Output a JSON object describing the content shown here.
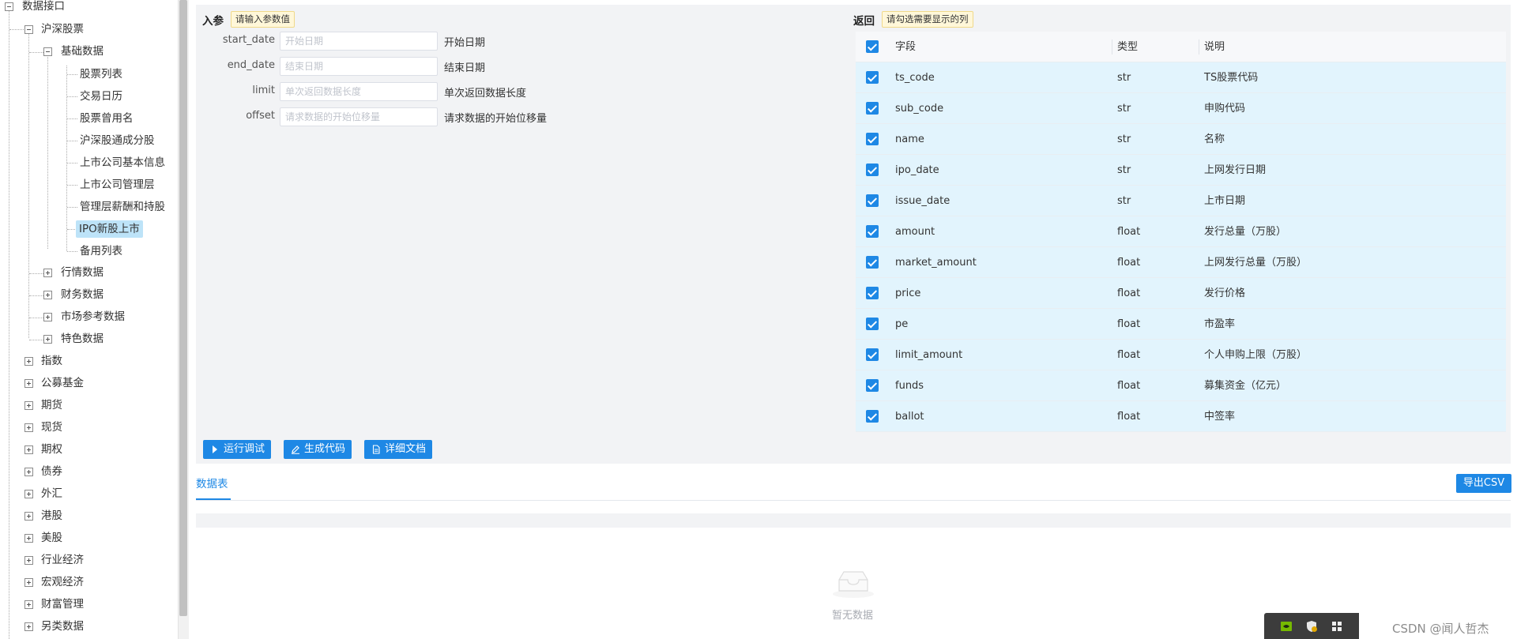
{
  "tree": {
    "root": "数据接口",
    "stock": "沪深股票",
    "basic": "基础数据",
    "leaves": [
      "股票列表",
      "交易日历",
      "股票曾用名",
      "沪深股通成分股",
      "上市公司基本信息",
      "上市公司管理层",
      "管理层薪酬和持股",
      "IPO新股上市",
      "备用列表"
    ],
    "stock_children": [
      "行情数据",
      "财务数据",
      "市场参考数据",
      "特色数据"
    ],
    "top_level": [
      "指数",
      "公募基金",
      "期货",
      "现货",
      "期权",
      "债券",
      "外汇",
      "港股",
      "美股",
      "行业经济",
      "宏观经济",
      "财富管理",
      "另类数据"
    ]
  },
  "params": {
    "title": "入参",
    "hint": "请输入参数值",
    "items": [
      {
        "label": "start_date",
        "placeholder": "开始日期",
        "desc": "开始日期"
      },
      {
        "label": "end_date",
        "placeholder": "结束日期",
        "desc": "结束日期"
      },
      {
        "label": "limit",
        "placeholder": "单次返回数据长度",
        "desc": "单次返回数据长度"
      },
      {
        "label": "offset",
        "placeholder": "请求数据的开始位移量",
        "desc": "请求数据的开始位移量"
      }
    ]
  },
  "returns": {
    "title": "返回",
    "hint": "请勾选需要显示的列",
    "headers": {
      "field": "字段",
      "type": "类型",
      "desc": "说明"
    },
    "rows": [
      {
        "field": "ts_code",
        "type": "str",
        "desc": "TS股票代码"
      },
      {
        "field": "sub_code",
        "type": "str",
        "desc": "申购代码"
      },
      {
        "field": "name",
        "type": "str",
        "desc": "名称"
      },
      {
        "field": "ipo_date",
        "type": "str",
        "desc": "上网发行日期"
      },
      {
        "field": "issue_date",
        "type": "str",
        "desc": "上市日期"
      },
      {
        "field": "amount",
        "type": "float",
        "desc": "发行总量（万股）"
      },
      {
        "field": "market_amount",
        "type": "float",
        "desc": "上网发行总量（万股）"
      },
      {
        "field": "price",
        "type": "float",
        "desc": "发行价格"
      },
      {
        "field": "pe",
        "type": "float",
        "desc": "市盈率"
      },
      {
        "field": "limit_amount",
        "type": "float",
        "desc": "个人申购上限（万股）"
      },
      {
        "field": "funds",
        "type": "float",
        "desc": "募集资金（亿元）"
      },
      {
        "field": "ballot",
        "type": "float",
        "desc": "中签率"
      }
    ]
  },
  "buttons": {
    "run": "运行调试",
    "gen_code": "生成代码",
    "docs": "详细文档"
  },
  "results": {
    "tab": "数据表",
    "export": "导出CSV",
    "empty": "暂无数据"
  },
  "watermark": "CSDN @闻人哲杰",
  "colors": {
    "accent": "#1e88e5",
    "row_bg": "#e2f4fd",
    "panel_bg": "#f2f3f5",
    "selected": "#bde3f8"
  }
}
